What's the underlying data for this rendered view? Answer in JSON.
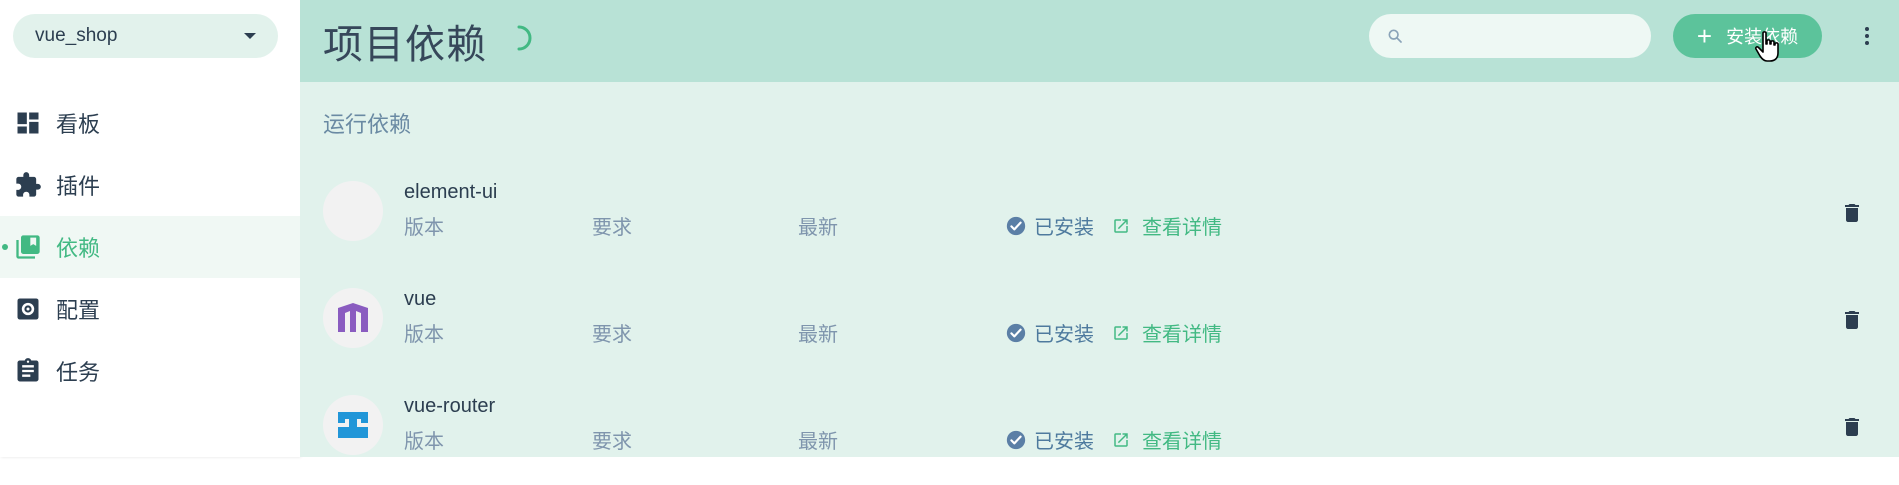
{
  "sidebar": {
    "project_name": "vue_shop",
    "items": [
      {
        "label": "看板",
        "icon": "dashboard-icon",
        "active": false
      },
      {
        "label": "插件",
        "icon": "puzzle-icon",
        "active": false
      },
      {
        "label": "依赖",
        "icon": "library-books-icon",
        "active": true
      },
      {
        "label": "配置",
        "icon": "settings-box-icon",
        "active": false
      },
      {
        "label": "任务",
        "icon": "clipboard-icon",
        "active": false
      }
    ]
  },
  "header": {
    "title": "项目依赖",
    "search_placeholder": "",
    "install_label": "安装依赖",
    "install_plus": "+"
  },
  "main": {
    "section_title": "运行依赖",
    "dependencies": [
      {
        "name": "element-ui",
        "version_label": "版本",
        "wanted_label": "要求",
        "latest_label": "最新",
        "status": "已安装",
        "details_label": "查看详情",
        "logo": "blank"
      },
      {
        "name": "vue",
        "version_label": "版本",
        "wanted_label": "要求",
        "latest_label": "最新",
        "status": "已安装",
        "details_label": "查看详情",
        "logo": "vue-logo"
      },
      {
        "name": "vue-router",
        "version_label": "版本",
        "wanted_label": "要求",
        "latest_label": "最新",
        "status": "已安装",
        "details_label": "查看详情",
        "logo": "vue-router-logo"
      }
    ]
  },
  "colors": {
    "accent": "#42b983",
    "header_bg": "#b8e2d6",
    "content_bg": "#e1f2ec",
    "install_button": "#5cc39b"
  }
}
